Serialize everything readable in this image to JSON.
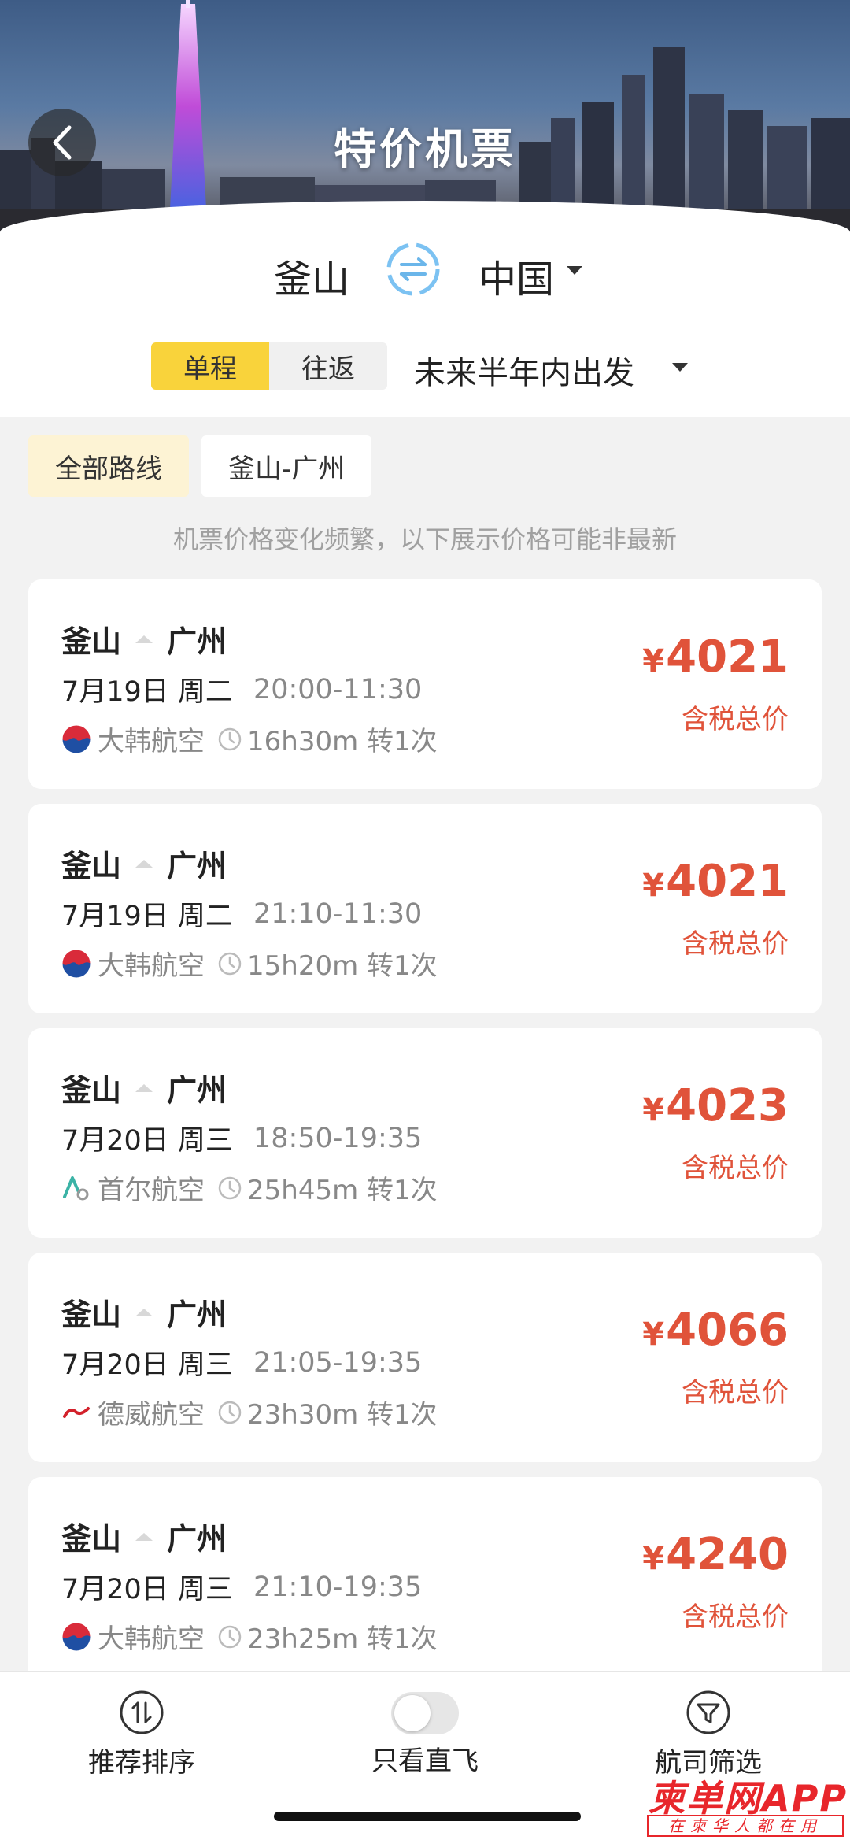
{
  "header": {
    "title": "特价机票"
  },
  "search": {
    "from_city": "釜山",
    "to_city": "中国",
    "trip_types": [
      {
        "label": "单程",
        "active": true
      },
      {
        "label": "往返",
        "active": false
      }
    ],
    "depart_range": "未来半年内出发"
  },
  "route_filters": [
    {
      "label": "全部路线",
      "active": true
    },
    {
      "label": "釜山-广州",
      "active": false
    }
  ],
  "notice": "机票价格变化频繁，以下展示价格可能非最新",
  "flights": [
    {
      "from": "釜山",
      "to": "广州",
      "date": "7月19日 周二",
      "time": "20:00-11:30",
      "airline": "大韩航空",
      "airline_logo": "korean-air-logo",
      "duration": "16h30m 转1次",
      "currency": "¥",
      "price": "4021",
      "price_note": "含税总价"
    },
    {
      "from": "釜山",
      "to": "广州",
      "date": "7月19日 周二",
      "time": "21:10-11:30",
      "airline": "大韩航空",
      "airline_logo": "korean-air-logo",
      "duration": "15h20m 转1次",
      "currency": "¥",
      "price": "4021",
      "price_note": "含税总价"
    },
    {
      "from": "釜山",
      "to": "广州",
      "date": "7月20日 周三",
      "time": "18:50-19:35",
      "airline": "首尔航空",
      "airline_logo": "air-seoul-logo",
      "duration": "25h45m 转1次",
      "currency": "¥",
      "price": "4023",
      "price_note": "含税总价"
    },
    {
      "from": "釜山",
      "to": "广州",
      "date": "7月20日 周三",
      "time": "21:05-19:35",
      "airline": "德威航空",
      "airline_logo": "tway-logo",
      "duration": "23h30m 转1次",
      "currency": "¥",
      "price": "4066",
      "price_note": "含税总价"
    },
    {
      "from": "釜山",
      "to": "广州",
      "date": "7月20日 周三",
      "time": "21:10-19:35",
      "airline": "大韩航空",
      "airline_logo": "korean-air-logo",
      "duration": "23h25m 转1次",
      "currency": "¥",
      "price": "4240",
      "price_note": "含税总价"
    }
  ],
  "bottom_bar": {
    "sort_label": "推荐排序",
    "direct_label": "只看直飞",
    "direct_on": false,
    "airline_filter_label": "航司筛选"
  },
  "watermark": {
    "brand": "柬单网APP",
    "tagline": "在柬华人都在用"
  },
  "colors": {
    "accent_yellow": "#f9d33b",
    "price_red": "#e0533a"
  }
}
